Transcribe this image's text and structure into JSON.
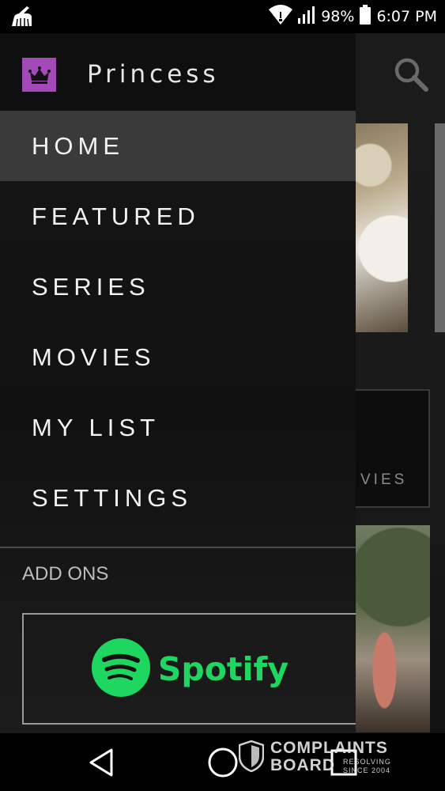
{
  "status_bar": {
    "battery_percent": "98%",
    "time": "6:07 PM",
    "icons": [
      "cleaner-icon",
      "wifi-icon",
      "cellular-signal-icon",
      "battery-icon"
    ]
  },
  "drawer": {
    "app_title": "Princess",
    "menu_items": [
      "HOME",
      "FEATURED",
      "SERIES",
      "MOVIES",
      "MY LIST",
      "SETTINGS"
    ],
    "active_item": "HOME",
    "section_label": "ADD ONS",
    "addon": {
      "name": "Spotify"
    }
  },
  "background": {
    "tile_label_partial": "VIES"
  },
  "watermark": {
    "line1": "COMPLAINTS",
    "line2": "BOARD",
    "tagline1": "RESOLVING",
    "tagline2": "SINCE 2004"
  },
  "colors": {
    "logo_bg": "#a349b8",
    "spotify_green": "#1ed760",
    "active_item_bg": "#3a3a3a"
  }
}
